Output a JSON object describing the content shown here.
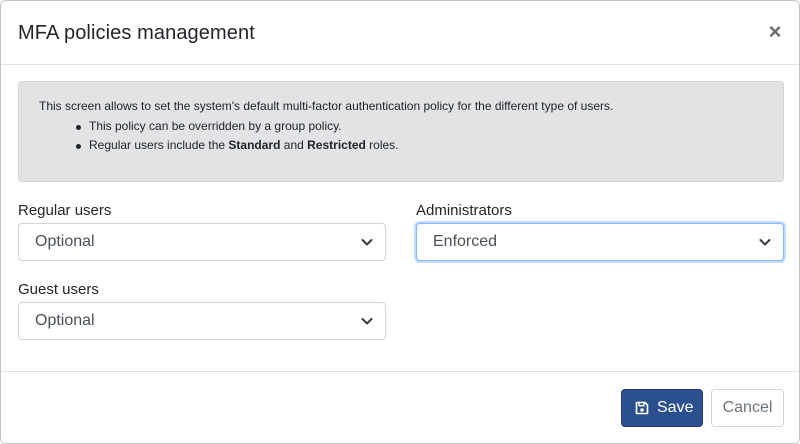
{
  "dialog": {
    "title": "MFA policies management",
    "close_label": "×"
  },
  "info": {
    "intro": "This screen allows to set the system's default multi-factor authentication policy for the different type of users.",
    "bullet1": "This policy can be overridden by a group policy.",
    "bullet2_prefix": "Regular users include the ",
    "bullet2_bold1": "Standard",
    "bullet2_mid": " and ",
    "bullet2_bold2": "Restricted",
    "bullet2_suffix": " roles."
  },
  "fields": {
    "regular": {
      "label": "Regular users",
      "value": "Optional"
    },
    "admins": {
      "label": "Administrators",
      "value": "Enforced"
    },
    "guest": {
      "label": "Guest users",
      "value": "Optional"
    }
  },
  "footer": {
    "save_label": "Save",
    "cancel_label": "Cancel"
  },
  "icons": {
    "close": "close-icon",
    "save": "floppy-disk-icon",
    "dropdown": "chevron-down-icon"
  },
  "colors": {
    "primary": "#2c4f8e",
    "info_bg": "#e2e3e5",
    "focus_ring": "#86b7fe"
  }
}
